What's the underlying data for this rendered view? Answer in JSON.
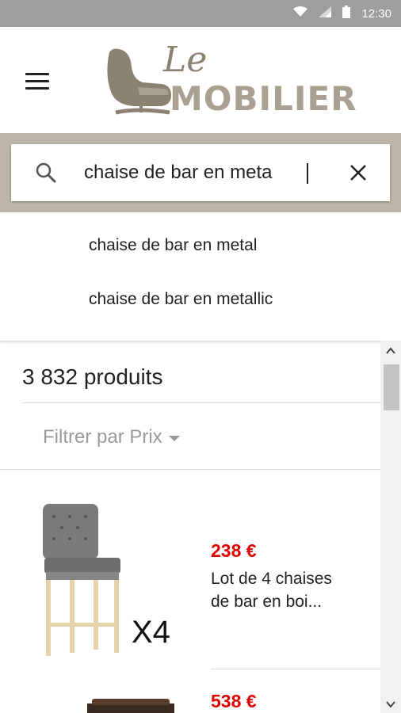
{
  "status_bar": {
    "time": "12:30",
    "icons": [
      "wifi-icon",
      "signal-icon",
      "battery-icon"
    ],
    "background": "#9e9e9e"
  },
  "header": {
    "menu_icon": "menu-icon",
    "logo": {
      "line1": "Le",
      "line2": "MOBILIER",
      "color": "#a8a090"
    }
  },
  "search": {
    "value": "chaise de bar en meta",
    "icon": "search-icon",
    "clear_icon": "close-icon",
    "band_color": "#bdb6a8"
  },
  "suggestions": [
    "chaise de bar en metal",
    "chaise de bar en metallic"
  ],
  "results": {
    "count": "3 832 produits",
    "filter_label": "Filtrer par Prix",
    "products": [
      {
        "price": "238 €",
        "title_line1": "Lot de 4 chaises",
        "title_line2": "de bar en boi...",
        "badge": "X4"
      },
      {
        "price": "538 €"
      }
    ],
    "price_color": "#e00000"
  }
}
